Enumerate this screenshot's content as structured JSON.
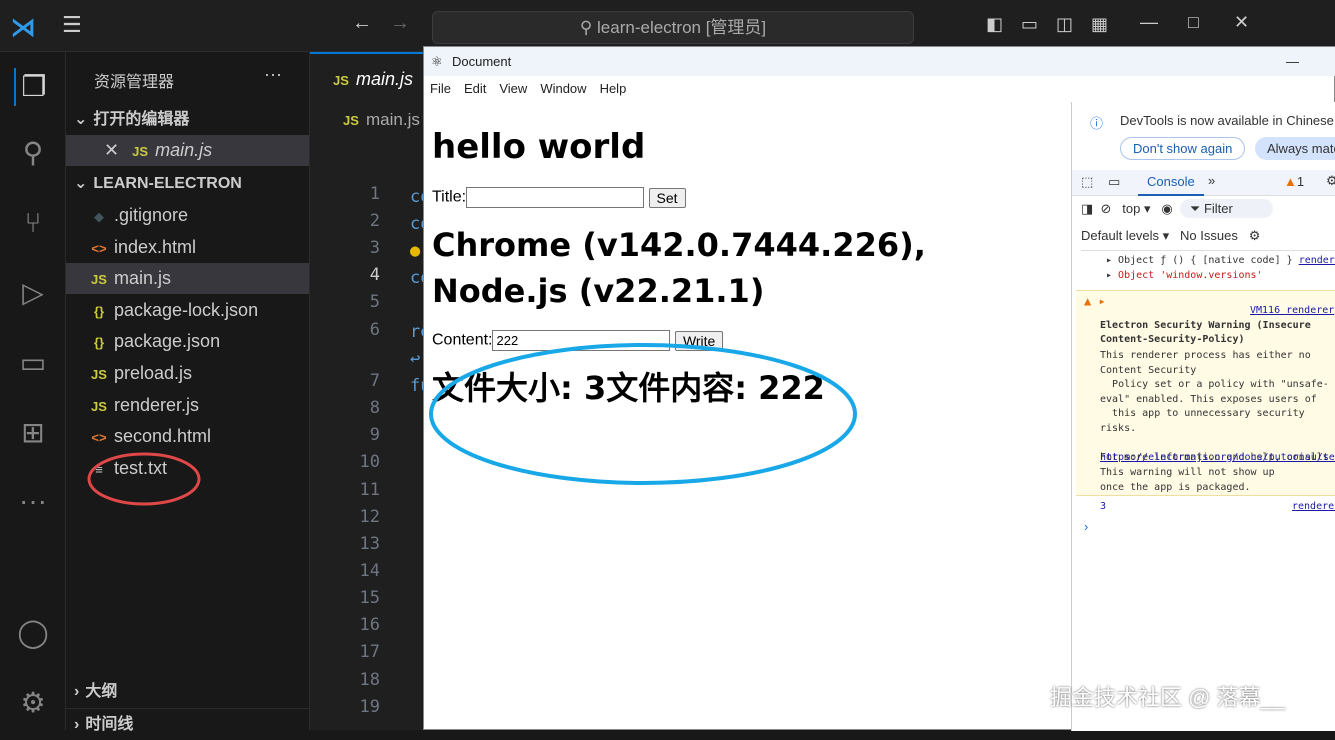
{
  "titlebar": {
    "search": "learn-electron [管理员]"
  },
  "sidebar": {
    "title": "资源管理器",
    "open_editors": "打开的编辑器",
    "open_file": "main.js",
    "project": "LEARN-ELECTRON",
    "files": [
      {
        "name": ".gitignore",
        "icon": "git"
      },
      {
        "name": "index.html",
        "icon": "html"
      },
      {
        "name": "main.js",
        "icon": "js"
      },
      {
        "name": "package-lock.json",
        "icon": "json"
      },
      {
        "name": "package.json",
        "icon": "json"
      },
      {
        "name": "preload.js",
        "icon": "js"
      },
      {
        "name": "renderer.js",
        "icon": "js"
      },
      {
        "name": "second.html",
        "icon": "html"
      },
      {
        "name": "test.txt",
        "icon": "txt"
      }
    ],
    "outline": "大纲",
    "timeline": "时间线"
  },
  "editor": {
    "tab": "main.js",
    "breadcrumb": "main.js",
    "lines": [
      "1",
      "2",
      "3",
      "4",
      "5",
      "6",
      "7",
      "8",
      "9",
      "10",
      "11",
      "12",
      "13",
      "14",
      "15",
      "16",
      "17",
      "18",
      "19"
    ]
  },
  "electron": {
    "title": "Document",
    "menu": [
      "File",
      "Edit",
      "View",
      "Window",
      "Help"
    ],
    "heading": "hello world",
    "title_label": "Title:",
    "set_btn": "Set",
    "versions": "Chrome (v142.0.7444.226), Node.js (v22.21.1)",
    "content_label": "Content:",
    "content_value": "222",
    "write_btn": "Write",
    "result": "文件大小: 3文件内容: 222"
  },
  "devtools": {
    "banner": "DevTools is now available in Chinese",
    "dont_show": "Don't show again",
    "always": "Always match",
    "tab": "Console",
    "warn_count": "1",
    "context": "top",
    "filter": "Filter",
    "levels": "Default levels",
    "issues": "No Issues",
    "log1": "Object ƒ () { [native code] }",
    "log1_src": "renderer",
    "log2": "Object 'window.versions'",
    "warn_src": "VM116 renderer",
    "warn_title": "Electron Security Warning (Insecure Content-Security-Policy)",
    "warn_body": "This renderer process has either no Content Security\n  Policy set or a policy with \"unsafe-eval\" enabled. This exposes users of\n  this app to unnecessary security risks.\n\nFor more information and help, consult",
    "warn_link": "https://electronjs.org/docs/tutorial/security.",
    "warn_tail": "This warning will not show up\nonce the app is packaged.",
    "log3": "3",
    "log3_src": "renderer"
  },
  "watermark": "掘金技术社区 @ 落幕__"
}
